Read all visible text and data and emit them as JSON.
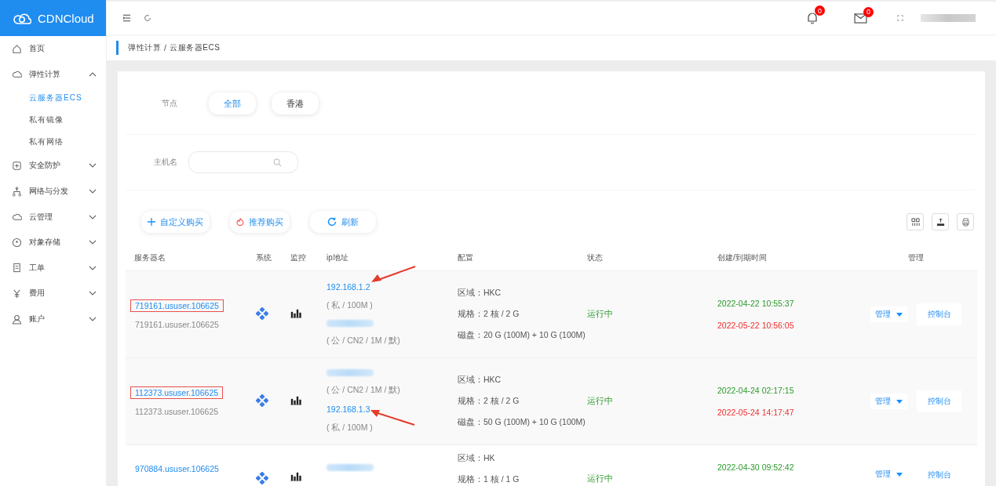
{
  "brand": {
    "name": "CDNCloud"
  },
  "sidebar": {
    "items": [
      {
        "label": "首页",
        "has_children": false
      },
      {
        "label": "弹性计算",
        "expanded": true,
        "has_children": true,
        "children": [
          {
            "label": "云服务器ECS",
            "selected": true
          },
          {
            "label": "私有镜像",
            "selected": false
          },
          {
            "label": "私有网络",
            "selected": false
          }
        ]
      },
      {
        "label": "安全防护",
        "expanded": false,
        "has_children": true
      },
      {
        "label": "网络与分发",
        "expanded": false,
        "has_children": true
      },
      {
        "label": "云管理",
        "expanded": false,
        "has_children": true
      },
      {
        "label": "对象存储",
        "expanded": false,
        "has_children": true
      },
      {
        "label": "工单",
        "expanded": false,
        "has_children": true
      },
      {
        "label": "费用",
        "expanded": false,
        "has_children": true
      },
      {
        "label": "账户",
        "expanded": false,
        "has_children": true
      }
    ]
  },
  "header": {
    "notifications": "0",
    "messages": "0"
  },
  "breadcrumb": {
    "items": [
      "弹性计算",
      "云服务器ECS"
    ],
    "separator": "/"
  },
  "filters": {
    "node_label": "节点",
    "nodes": [
      {
        "label": "全部",
        "selected": true
      },
      {
        "label": "香港",
        "selected": false
      }
    ],
    "host_label": "主机名"
  },
  "actions": [
    {
      "label": "自定义购买",
      "kind": "plus"
    },
    {
      "label": "推荐购买",
      "kind": "flame"
    },
    {
      "label": "刷新",
      "kind": "refresh"
    }
  ],
  "table": {
    "columns": [
      "服务器名",
      "系统",
      "监控",
      "ip地址",
      "配置",
      "状态",
      "创建/到期时间",
      "管理"
    ],
    "rows": [
      {
        "name": "719161.ususer.106625",
        "highlighted": true,
        "subname": "719161.ususer.106625",
        "ips": [
          {
            "kind": "address",
            "text": "192.168.1.2",
            "marked": true
          },
          {
            "kind": "note",
            "text": "( 私 / 100M )"
          },
          {
            "kind": "redacted"
          },
          {
            "kind": "note",
            "text": "( 公 / CN2 / 1M / 默)"
          }
        ],
        "config": [
          "区域：HKC",
          "规格：2 核 / 2 G",
          "磁盘：20 G (100M) + 10 G (100M)"
        ],
        "status": "运行中",
        "created": "2022-04-22 10:55:37",
        "expires": "2022-05-22 10:56:05",
        "manage": "管理",
        "console": "控制台"
      },
      {
        "name": "112373.ususer.106625",
        "highlighted": true,
        "subname": "112373.ususer.106625",
        "ips": [
          {
            "kind": "redacted"
          },
          {
            "kind": "note",
            "text": "( 公 / CN2 / 1M / 默)"
          },
          {
            "kind": "address",
            "text": "192.168.1.3",
            "marked": true
          },
          {
            "kind": "note",
            "text": "( 私 / 100M )"
          }
        ],
        "config": [
          "区域：HKC",
          "规格：2 核 / 2 G",
          "磁盘：50 G (100M) + 10 G (100M)"
        ],
        "status": "运行中",
        "created": "2022-04-24 02:17:15",
        "expires": "2022-05-24 14:17:47",
        "manage": "管理",
        "console": "控制台"
      },
      {
        "name": "970884.ususer.106625",
        "highlighted": false,
        "ips": [
          {
            "kind": "redacted"
          }
        ],
        "config": [
          "区域：HK",
          "规格：1 核 / 1 G"
        ],
        "status": "运行中",
        "created": "2022-04-30 09:52:42",
        "manage": "管理",
        "console": "控制台"
      }
    ]
  }
}
